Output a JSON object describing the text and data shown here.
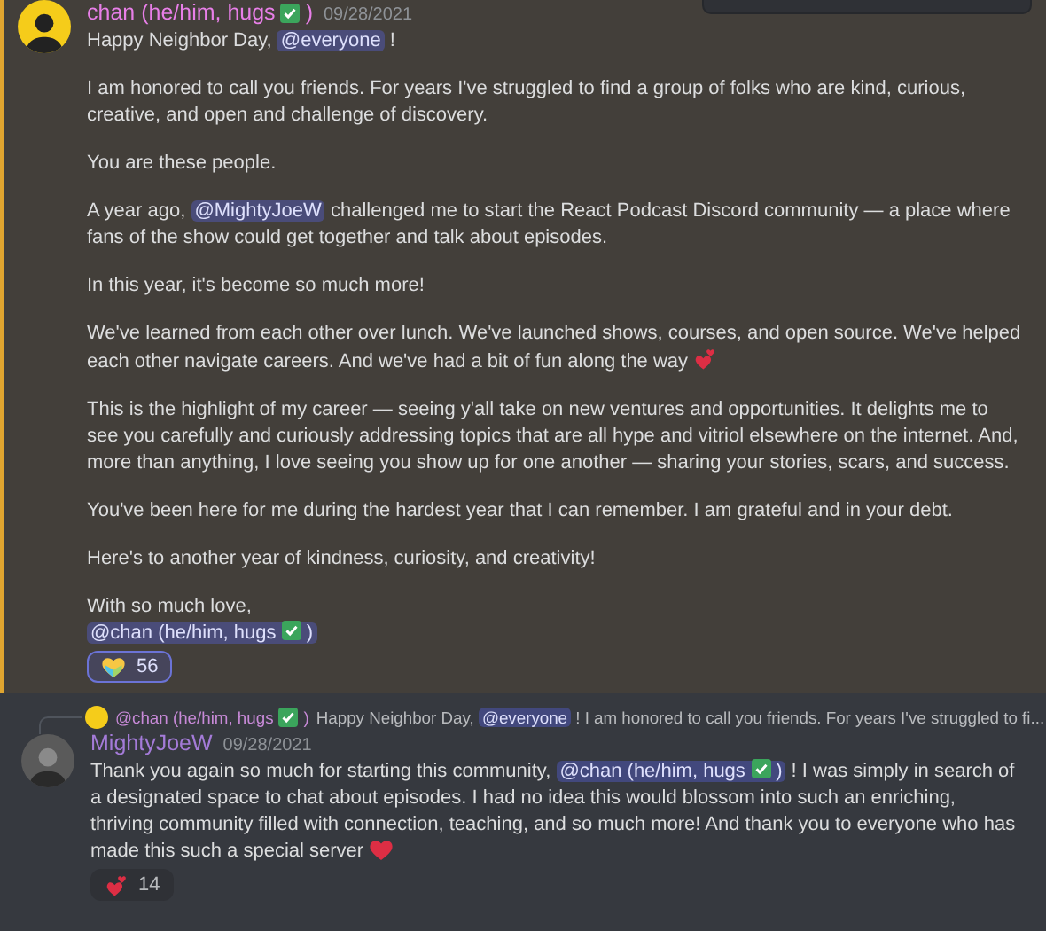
{
  "messages": [
    {
      "highlighted": true,
      "author": {
        "name_start": "chan (he/him, hugs",
        "verified": true,
        "name_end": ")",
        "color": "#e87fe8"
      },
      "timestamp": "09/28/2021",
      "paragraphs": [
        [
          {
            "kind": "text",
            "text": "Happy Neighbor Day, "
          },
          {
            "kind": "mention",
            "text": "@everyone"
          },
          {
            "kind": "text",
            "text": " !"
          }
        ],
        [
          {
            "kind": "text",
            "text": "I am honored to call you friends. For years I've struggled to find a group of folks who are kind, curious, creative, and open and challenge of discovery."
          }
        ],
        [
          {
            "kind": "text",
            "text": "You are these people."
          }
        ],
        [
          {
            "kind": "text",
            "text": "A year ago, "
          },
          {
            "kind": "mention",
            "text": "@MightyJoeW"
          },
          {
            "kind": "text",
            "text": " challenged me to start the React Podcast Discord community — a place where fans of the show could get together and talk about episodes."
          }
        ],
        [
          {
            "kind": "text",
            "text": "In this year, it's become so much more!"
          }
        ],
        [
          {
            "kind": "text",
            "text": "We've learned from each other over lunch. We've launched shows, courses, and open source. We've helped each other navigate careers. And we've had a bit of fun along the way "
          },
          {
            "kind": "hearts-emoji"
          }
        ],
        [
          {
            "kind": "text",
            "text": "This is the highlight of my career —  seeing y'all take on new ventures and opportunities. It delights me to see you carefully and curiously addressing topics that are all hype and vitriol elsewhere on the internet. And, more than anything, I love seeing you show up for one another — sharing your stories, scars, and success."
          }
        ],
        [
          {
            "kind": "text",
            "text": "You've been here for me during the hardest year that I can remember. I am grateful and in your debt."
          }
        ],
        [
          {
            "kind": "text",
            "text": "Here's to another year of kindness, curiosity, and creativity!"
          }
        ],
        [
          {
            "kind": "text",
            "text": "With so much love,"
          },
          {
            "kind": "break"
          },
          {
            "kind": "mention",
            "text": "@chan (he/him, hugs",
            "verified": true,
            "text_after": ")"
          }
        ]
      ],
      "reactions": [
        {
          "kind": "rainbow-heart",
          "count": "56",
          "selected": true
        }
      ]
    },
    {
      "highlighted": false,
      "reply": {
        "author_start": "@chan (he/him, hugs",
        "verified": true,
        "author_end": ")",
        "segments": [
          {
            "kind": "text",
            "text": "Happy Neighbor Day, "
          },
          {
            "kind": "mention",
            "text": "@everyone"
          },
          {
            "kind": "text",
            "text": " !  I am honored to call you friends. For years I've struggled to fi..."
          }
        ]
      },
      "author": {
        "name_start": "MightyJoeW",
        "color": "#a47bd8"
      },
      "timestamp": "09/28/2021",
      "paragraphs": [
        [
          {
            "kind": "text",
            "text": "Thank you again so much for starting this community, "
          },
          {
            "kind": "mention",
            "text": "@chan (he/him, hugs",
            "verified": true,
            "text_after": ")"
          },
          {
            "kind": "text",
            "text": " ! I was simply in search of a designated space to chat about episodes. I had no idea this would blossom into such an enriching, thriving community filled with connection, teaching, and so much more! And thank you to everyone who has made this such a special server "
          },
          {
            "kind": "heart-emoji"
          }
        ]
      ],
      "reactions": [
        {
          "kind": "hearts",
          "count": "14",
          "selected": false
        }
      ]
    }
  ]
}
